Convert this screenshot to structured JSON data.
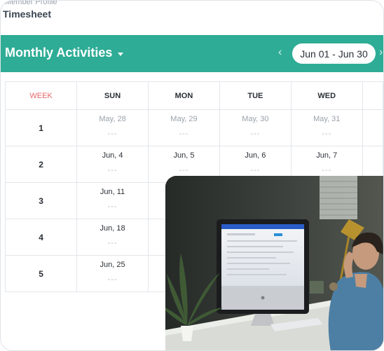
{
  "header": {
    "breadcrumb": "Member Profile",
    "title": "Timesheet"
  },
  "toolbar": {
    "title": "Monthly Activities",
    "range": "Jun 01 - Jun 30",
    "prev": "‹",
    "next": "›"
  },
  "calendar": {
    "week_header": "WEEK",
    "days": [
      "SUN",
      "MON",
      "TUE",
      "WED"
    ],
    "empty": "---",
    "rows": [
      {
        "week": "1",
        "dates": [
          "May, 28",
          "May, 29",
          "May, 30",
          "May, 31"
        ]
      },
      {
        "week": "2",
        "dates": [
          "Jun, 4",
          "Jun, 5",
          "Jun, 6",
          "Jun, 7"
        ]
      },
      {
        "week": "3",
        "dates": [
          "Jun, 11"
        ]
      },
      {
        "week": "4",
        "dates": [
          "Jun, 18"
        ]
      },
      {
        "week": "5",
        "dates": [
          "Jun, 25"
        ]
      }
    ]
  },
  "colors": {
    "accent": "#2eac95",
    "week_header": "#e8676b"
  }
}
